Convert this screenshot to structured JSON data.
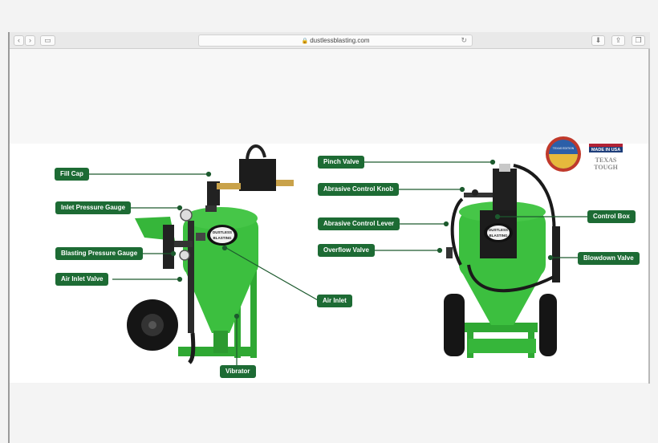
{
  "browser": {
    "url": "dustlessblasting.com",
    "back": "‹",
    "forward": "›",
    "sidebar": "▭",
    "reload": "↻",
    "download": "⬇",
    "share": "⇪",
    "tabs": "❐"
  },
  "labels": {
    "fill_cap": "Fill Cap",
    "inlet_pressure_gauge": "Inlet Pressure Gauge",
    "blasting_pressure_gauge": "Blasting Pressure Gauge",
    "air_inlet_valve": "Air Inlet Valve",
    "air_inlet": "Air Inlet",
    "vibrator": "Vibrator",
    "pinch_valve": "Pinch Valve",
    "abrasive_control_knob": "Abrasive Control Knob",
    "abrasive_control_lever": "Abrasive Control Lever",
    "overflow_valve": "Overflow Valve",
    "control_box": "Control Box",
    "blowdown_valve": "Blowdown Valve"
  },
  "logo": {
    "line1": "DUSTLESS",
    "line2": "BLASTING"
  },
  "badges": {
    "made_in_usa": "MADE IN USA",
    "texas_tough_1": "TEXAS",
    "texas_tough_2": "TOUGH",
    "texas_edition": "TEXAS EDITION"
  },
  "colors": {
    "label_bg": "#1d6b34",
    "machine_green": "#3cbf3f",
    "line": "#1d5a2e"
  }
}
